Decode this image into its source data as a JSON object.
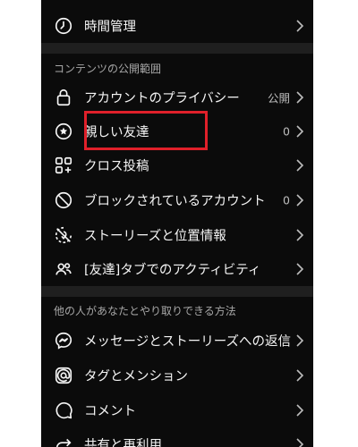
{
  "rows_top": [
    {
      "key": "time",
      "label": "時間管理",
      "icon": "clock-icon"
    }
  ],
  "section1": {
    "title": "コンテンツの公開範囲",
    "items": [
      {
        "label": "アカウントのプライバシー",
        "value": "公開",
        "icon": "lock-icon"
      },
      {
        "label": "親しい友達",
        "value": "0",
        "icon": "close-friends-star-icon"
      },
      {
        "label": "クロス投稿",
        "value": "",
        "icon": "cross-post-icon"
      },
      {
        "label": "ブロックされているアカウント",
        "value": "0",
        "icon": "block-icon"
      },
      {
        "label": "ストーリーズと位置情報",
        "value": "",
        "icon": "story-location-icon"
      },
      {
        "label": "[友達]タブでのアクティビティ",
        "value": "",
        "icon": "friends-icon"
      }
    ]
  },
  "section2": {
    "title": "他の人があなたとやり取りできる方法",
    "items": [
      {
        "label": "メッセージとストーリーズへの返信",
        "icon": "messenger-icon"
      },
      {
        "label": "タグとメンション",
        "icon": "at-sign-icon"
      },
      {
        "label": "コメント",
        "icon": "comment-icon"
      },
      {
        "label": "共有と再利用",
        "icon": "share-icon"
      }
    ]
  },
  "colors": {
    "background": "#0b0b0b",
    "divider": "#1f1f1f",
    "highlight": "#e0202a"
  }
}
